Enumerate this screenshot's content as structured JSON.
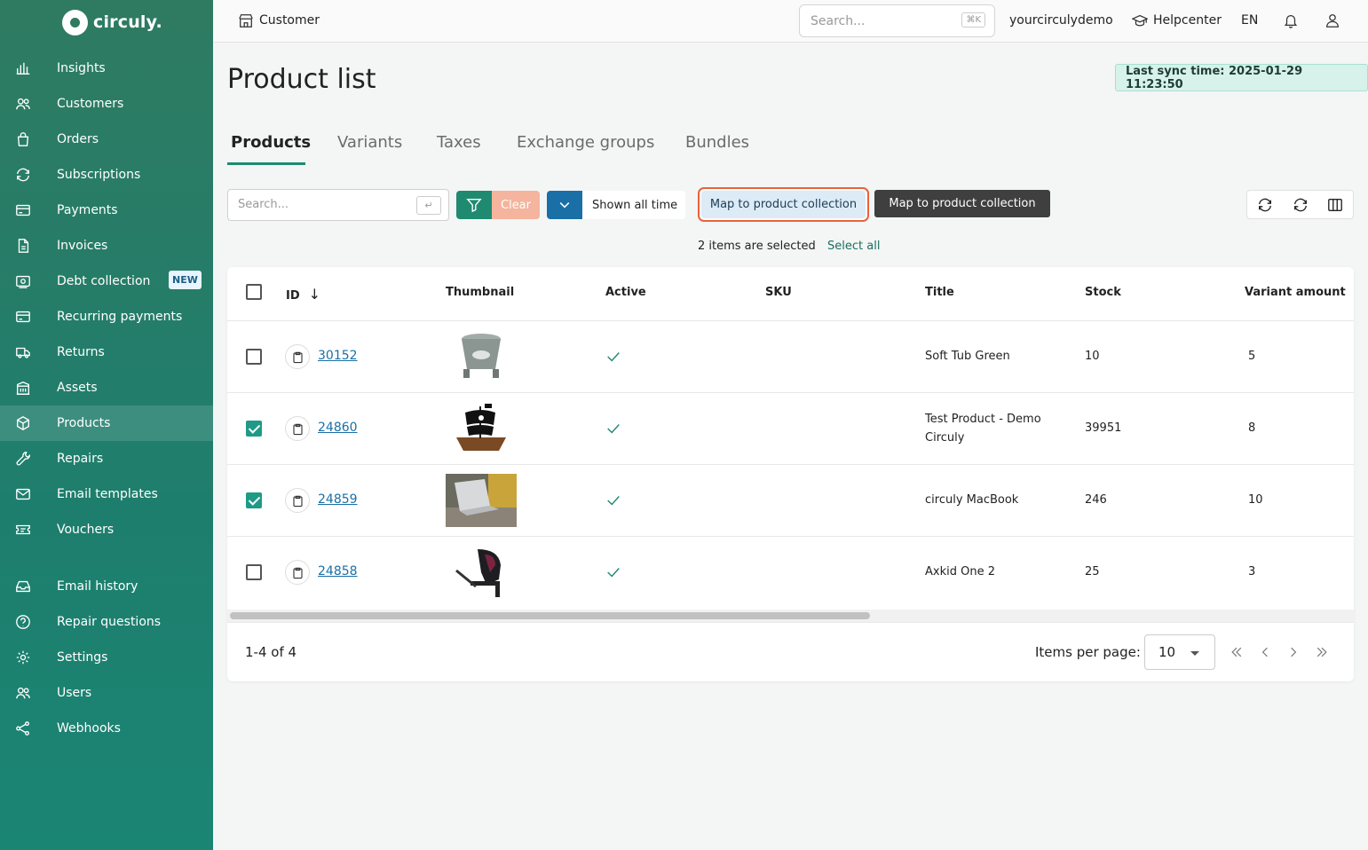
{
  "brand": {
    "name": "circuly."
  },
  "sidebar": {
    "items": [
      {
        "label": "Insights",
        "icon": "bar-chart-icon"
      },
      {
        "label": "Customers",
        "icon": "users-icon"
      },
      {
        "label": "Orders",
        "icon": "shopping-bag-icon"
      },
      {
        "label": "Subscriptions",
        "icon": "refresh-icon"
      },
      {
        "label": "Payments",
        "icon": "credit-card-icon"
      },
      {
        "label": "Invoices",
        "icon": "document-icon"
      },
      {
        "label": "Debt collection",
        "icon": "money-icon",
        "badge": "NEW"
      },
      {
        "label": "Recurring payments",
        "icon": "credit-card-icon"
      },
      {
        "label": "Returns",
        "icon": "truck-icon"
      },
      {
        "label": "Assets",
        "icon": "building-icon"
      },
      {
        "label": "Products",
        "icon": "box-icon",
        "active": true
      },
      {
        "label": "Repairs",
        "icon": "wrench-icon"
      },
      {
        "label": "Email templates",
        "icon": "mail-icon"
      },
      {
        "label": "Vouchers",
        "icon": "ticket-icon"
      },
      {
        "label": "Email history",
        "icon": "inbox-icon"
      },
      {
        "label": "Repair questions",
        "icon": "question-icon"
      },
      {
        "label": "Settings",
        "icon": "gear-icon"
      },
      {
        "label": "Users",
        "icon": "users-icon"
      },
      {
        "label": "Webhooks",
        "icon": "share-icon"
      }
    ]
  },
  "topbar": {
    "context": "Customer",
    "search_placeholder": "Search...",
    "search_shortcut": "⌘K",
    "account": "yourcirculydemo",
    "help": "Helpcenter",
    "language": "EN"
  },
  "page": {
    "title": "Product list",
    "sync": "Last sync time: 2025-01-29 11:23:50"
  },
  "tabs": [
    "Products",
    "Variants",
    "Taxes",
    "Exchange groups",
    "Bundles"
  ],
  "toolbar": {
    "search_placeholder": "Search...",
    "enter_key": "↵",
    "clear": "Clear",
    "date_range": "Shown all time",
    "map_button": "Map to product collection",
    "tooltip": "Map to product collection"
  },
  "selection": {
    "text": "2 items are selected",
    "select_all": "Select all"
  },
  "table": {
    "columns": [
      "ID",
      "Thumbnail",
      "Active",
      "SKU",
      "Title",
      "Stock",
      "Variant amount"
    ],
    "rows": [
      {
        "id": "30152",
        "checked": false,
        "active": true,
        "sku": "",
        "title": "Soft Tub Green",
        "stock": "10",
        "variants": "5",
        "thumb": "tub"
      },
      {
        "id": "24860",
        "checked": true,
        "active": true,
        "sku": "",
        "title": "Test Product - Demo Circuly",
        "stock": "39951",
        "variants": "8",
        "thumb": "ship"
      },
      {
        "id": "24859",
        "checked": true,
        "active": true,
        "sku": "",
        "title": "circuly MacBook",
        "stock": "246",
        "variants": "10",
        "thumb": "laptop"
      },
      {
        "id": "24858",
        "checked": false,
        "active": true,
        "sku": "",
        "title": "Axkid One 2",
        "stock": "25",
        "variants": "3",
        "thumb": "carseat"
      }
    ]
  },
  "pagination": {
    "range": "1-4 of 4",
    "per_page_label": "Items per page:",
    "per_page": "10"
  },
  "colors": {
    "sidebar": "#2f7b62",
    "accent": "#1f8a70",
    "link": "#1a6fa6",
    "highlight": "#e9623a"
  }
}
